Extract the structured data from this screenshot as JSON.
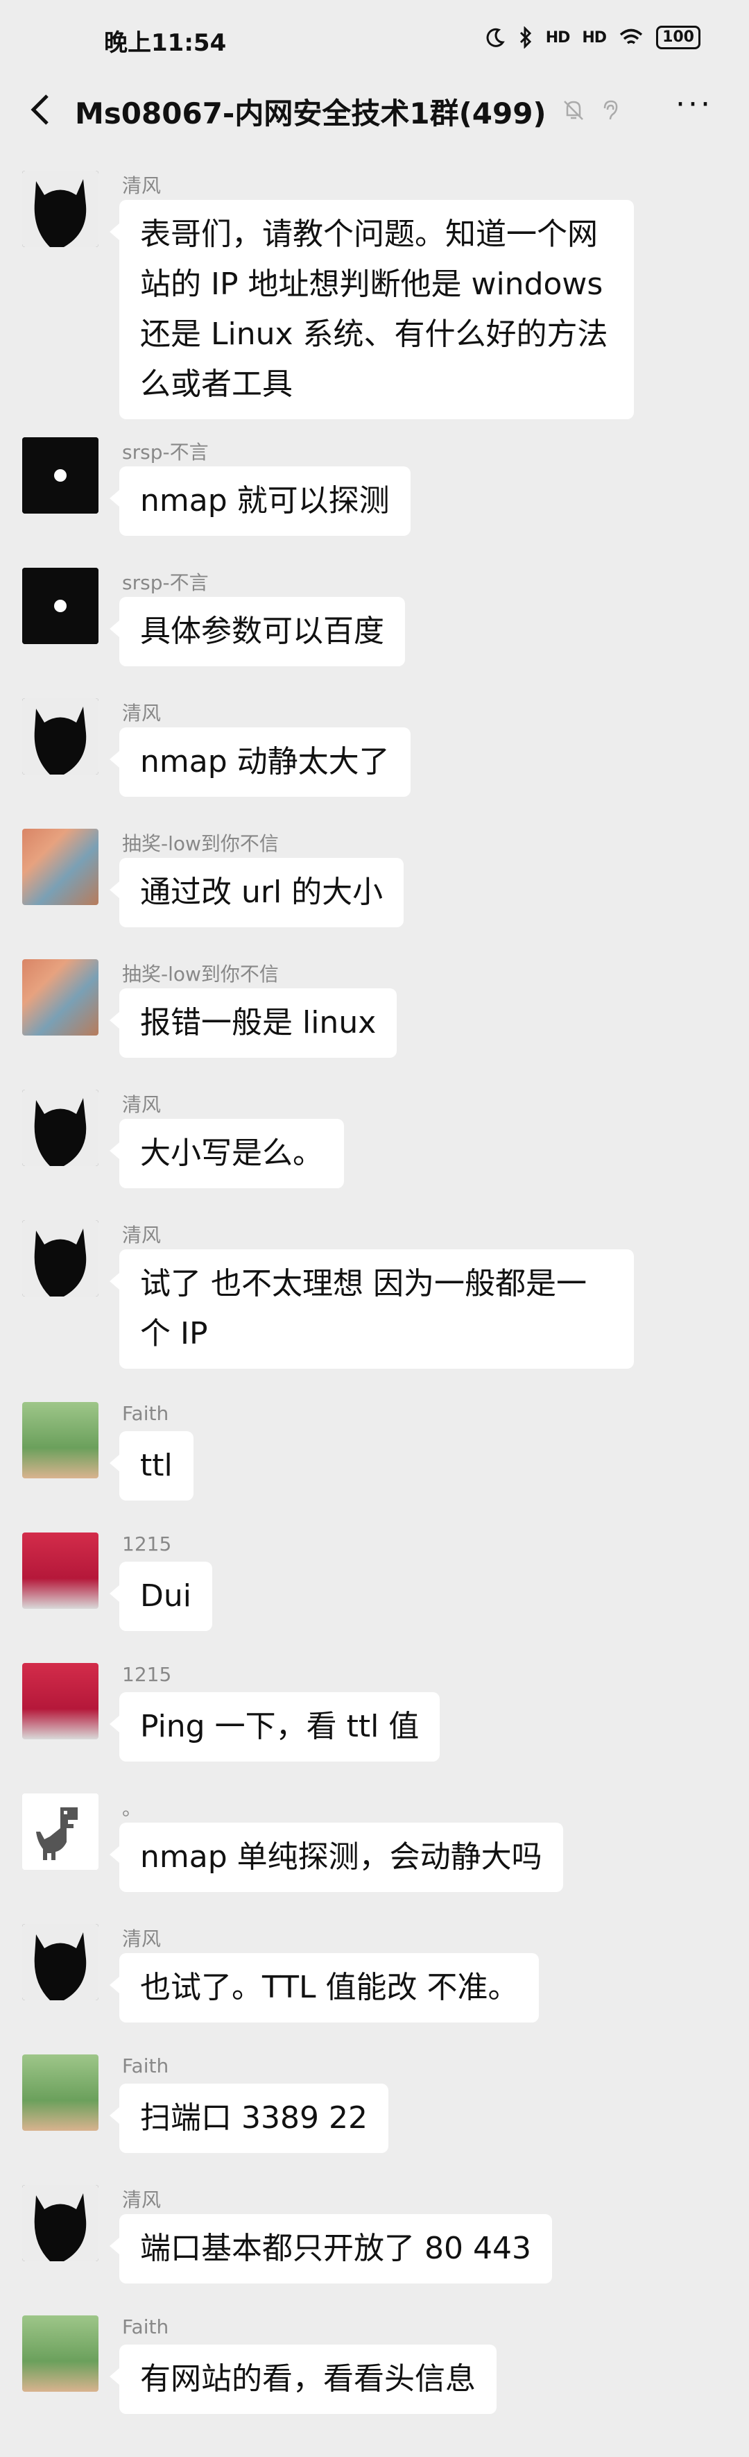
{
  "status_bar": {
    "time": "晚上11:54",
    "signal1": "HD",
    "signal2": "HD",
    "battery": "100"
  },
  "header": {
    "title": "Ms08067-内网安全技术1群(499)"
  },
  "messages": [
    {
      "sender": "清风",
      "text": "表哥们，请教个问题。知道一个网\n站的 IP 地址想判断他是 windows\n还是 Linux 系统、有什么好的方法\n么或者工具",
      "avatar": "black-cat-avatar"
    },
    {
      "sender": "srsp-不言",
      "text": "nmap 就可以探测",
      "avatar": "dark-dot-avatar"
    },
    {
      "sender": "srsp-不言",
      "text": "具体参数可以百度",
      "avatar": "dark-dot-avatar"
    },
    {
      "sender": "清风",
      "text": "nmap 动静太大了",
      "avatar": "black-cat-avatar"
    },
    {
      "sender": "抽奖-low到你不信",
      "text": "通过改 url 的大小",
      "avatar": "anime-avatar"
    },
    {
      "sender": "抽奖-low到你不信",
      "text": "报错一般是 linux",
      "avatar": "anime-avatar"
    },
    {
      "sender": "清风",
      "text": "大小写是么。",
      "avatar": "black-cat-avatar"
    },
    {
      "sender": "清风",
      "text": "试了 也不太理想 因为一般都是一\n个 IP",
      "avatar": "black-cat-avatar"
    },
    {
      "sender": "Faith",
      "text": "ttl",
      "avatar": "baby-avatar"
    },
    {
      "sender": "1215",
      "text": "Dui",
      "avatar": "red-avatar"
    },
    {
      "sender": "1215",
      "text": "Ping 一下，看 ttl 值",
      "avatar": "red-avatar"
    },
    {
      "sender": "。",
      "text": "nmap 单纯探测，会动静大吗",
      "avatar": "dino-avatar"
    },
    {
      "sender": "清风",
      "text": "也试了。TTL 值能改 不准。",
      "avatar": "black-cat-avatar"
    },
    {
      "sender": "Faith",
      "text": "扫端口 3389 22",
      "avatar": "baby-avatar"
    },
    {
      "sender": "清风",
      "text": "端口基本都只开放了 80 443",
      "avatar": "black-cat-avatar"
    },
    {
      "sender": "Faith",
      "text": "有网站的看，看看头信息",
      "avatar": "baby-avatar"
    }
  ]
}
